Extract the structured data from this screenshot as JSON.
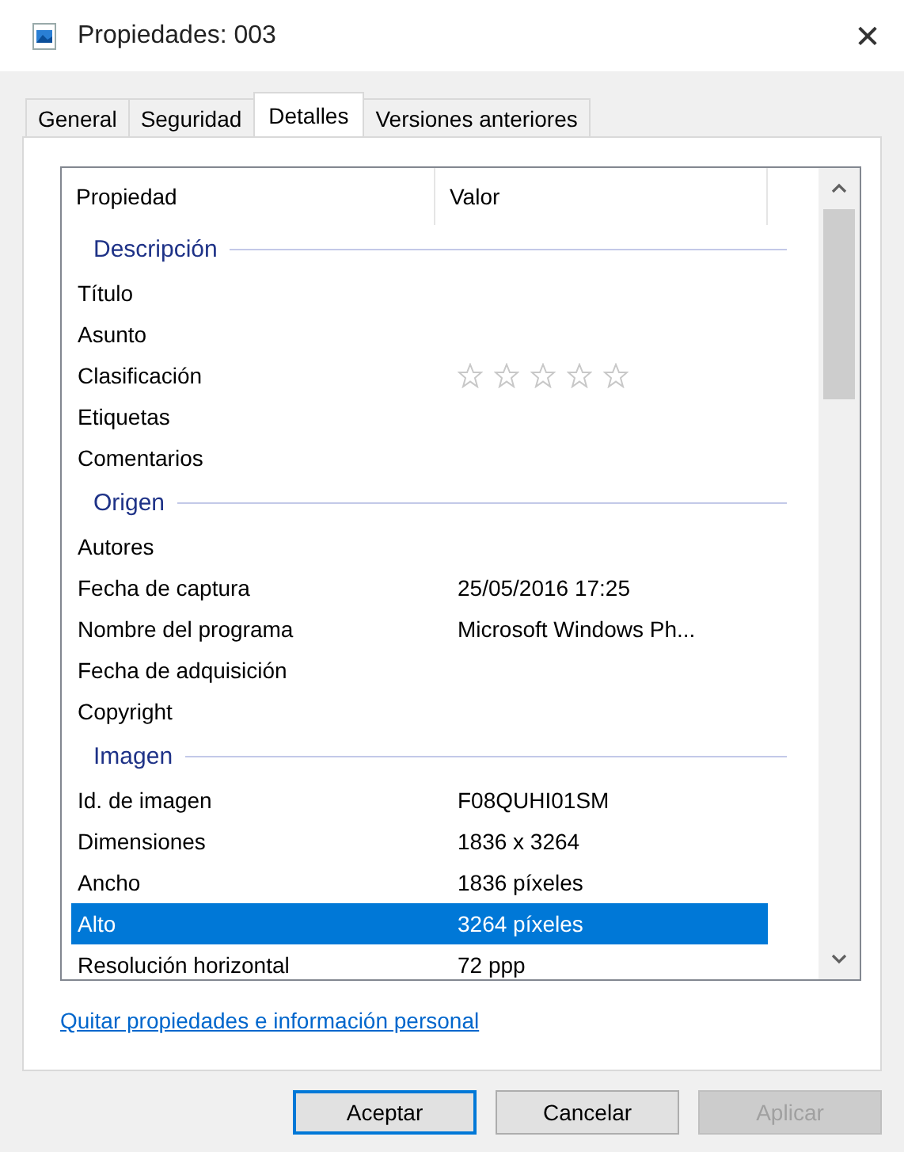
{
  "window": {
    "title": "Propiedades: 003",
    "close": "✕"
  },
  "tabs": [
    {
      "label": "General",
      "selected": false
    },
    {
      "label": "Seguridad",
      "selected": false
    },
    {
      "label": "Detalles",
      "selected": true
    },
    {
      "label": "Versiones anteriores",
      "selected": false
    }
  ],
  "list": {
    "columns": [
      "Propiedad",
      "Valor"
    ],
    "groups": [
      {
        "name": "Descripción",
        "rows": [
          {
            "kind": "text",
            "property": "Título",
            "selected": false
          },
          {
            "kind": "text",
            "property": "Asunto",
            "selected": false
          },
          {
            "kind": "rating",
            "property": "Clasificación",
            "stars": 0,
            "selected": false
          },
          {
            "kind": "text",
            "property": "Etiquetas",
            "selected": false
          },
          {
            "kind": "text",
            "property": "Comentarios",
            "selected": false
          }
        ]
      },
      {
        "name": "Origen",
        "rows": [
          {
            "kind": "text",
            "property": "Autores",
            "selected": false
          },
          {
            "kind": "text",
            "property": "Fecha de captura",
            "value": "25/05/2016 17:25",
            "selected": false
          },
          {
            "kind": "text",
            "property": "Nombre del programa",
            "value": "Microsoft Windows Ph...",
            "selected": false
          },
          {
            "kind": "text",
            "property": "Fecha de adquisición",
            "selected": false
          },
          {
            "kind": "text",
            "property": "Copyright",
            "selected": false
          }
        ]
      },
      {
        "name": "Imagen",
        "rows": [
          {
            "kind": "text",
            "property": "Id. de imagen",
            "value": "F08QUHI01SM",
            "selected": false
          },
          {
            "kind": "text",
            "property": "Dimensiones",
            "value": "1836 x 3264",
            "selected": false
          },
          {
            "kind": "text",
            "property": "Ancho",
            "value": "1836 píxeles",
            "selected": false
          },
          {
            "kind": "text",
            "property": "Alto",
            "value": "3264 píxeles",
            "selected": true
          },
          {
            "kind": "text",
            "property": "Resolución horizontal",
            "value": "72 ppp",
            "selected": false
          }
        ]
      }
    ]
  },
  "link": "Quitar propiedades e información personal",
  "buttons": [
    {
      "label": "Aceptar",
      "disabled": false,
      "default": true
    },
    {
      "label": "Cancelar",
      "disabled": false,
      "default": false
    },
    {
      "label": "Aplicar",
      "disabled": true,
      "default": false
    }
  ]
}
